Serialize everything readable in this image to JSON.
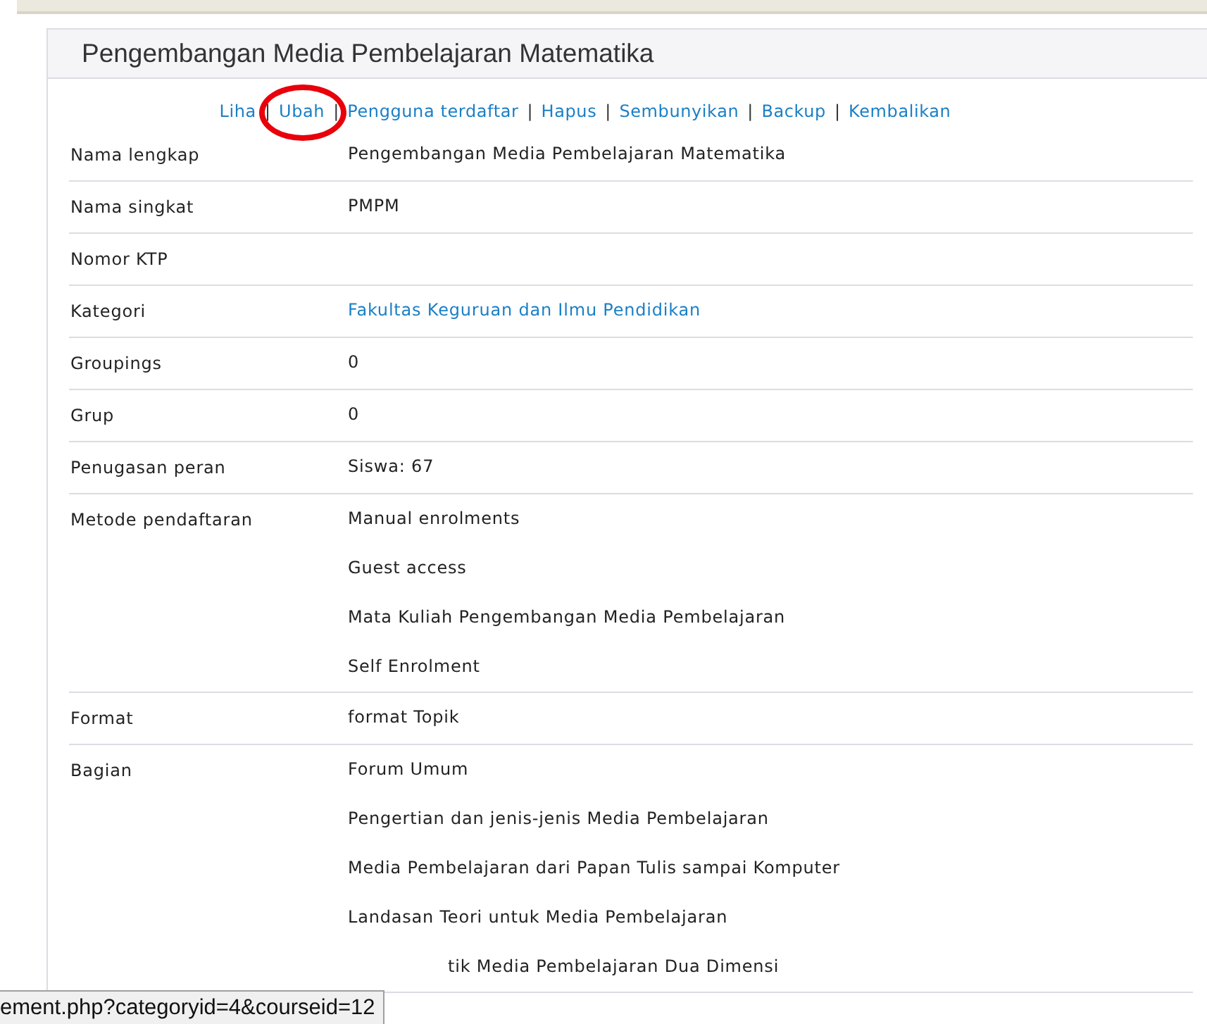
{
  "panel": {
    "title": "Pengembangan Media Pembelajaran Matematika"
  },
  "actions": {
    "separator": "|",
    "links": [
      {
        "label": "Liha"
      },
      {
        "label": "Ubah",
        "annotated": true
      },
      {
        "label": "Pengguna terdaftar"
      },
      {
        "label": "Hapus"
      },
      {
        "label": "Sembunyikan"
      },
      {
        "label": "Backup"
      },
      {
        "label": "Kembalikan"
      }
    ]
  },
  "rows": [
    {
      "label": "Nama lengkap",
      "values": [
        {
          "text": "Pengembangan Media Pembelajaran Matematika",
          "kind": "text"
        }
      ]
    },
    {
      "label": "Nama singkat",
      "values": [
        {
          "text": "PMPM",
          "kind": "text"
        }
      ]
    },
    {
      "label": "Nomor KTP",
      "values": []
    },
    {
      "label": "Kategori",
      "values": [
        {
          "text": "Fakultas Keguruan dan Ilmu Pendidikan",
          "kind": "link"
        }
      ]
    },
    {
      "label": "Groupings",
      "values": [
        {
          "text": "0",
          "kind": "text"
        }
      ]
    },
    {
      "label": "Grup",
      "values": [
        {
          "text": "0",
          "kind": "text"
        }
      ]
    },
    {
      "label": "Penugasan peran",
      "values": [
        {
          "text": "Siswa: 67",
          "kind": "text"
        }
      ]
    },
    {
      "label": "Metode pendaftaran",
      "values": [
        {
          "text": "Manual enrolments",
          "kind": "text"
        },
        {
          "text": "Guest access",
          "kind": "text"
        },
        {
          "text": "Mata Kuliah Pengembangan Media Pembelajaran",
          "kind": "text"
        },
        {
          "text": "Self Enrolment",
          "kind": "text"
        }
      ]
    },
    {
      "label": "Format",
      "values": [
        {
          "text": "format Topik",
          "kind": "text"
        }
      ]
    },
    {
      "label": "Bagian",
      "values": [
        {
          "text": "Forum Umum",
          "kind": "text"
        },
        {
          "text": "Pengertian dan jenis-jenis Media Pembelajaran",
          "kind": "text"
        },
        {
          "text": "Media Pembelajaran dari Papan Tulis sampai Komputer",
          "kind": "text"
        },
        {
          "text": "Landasan Teori untuk Media Pembelajaran",
          "kind": "text"
        },
        {
          "text": "tik Media Pembelajaran Dua Dimensi",
          "kind": "covered"
        }
      ]
    }
  ],
  "status_bar": {
    "url": "ement.php?categoryid=4&courseid=12"
  }
}
